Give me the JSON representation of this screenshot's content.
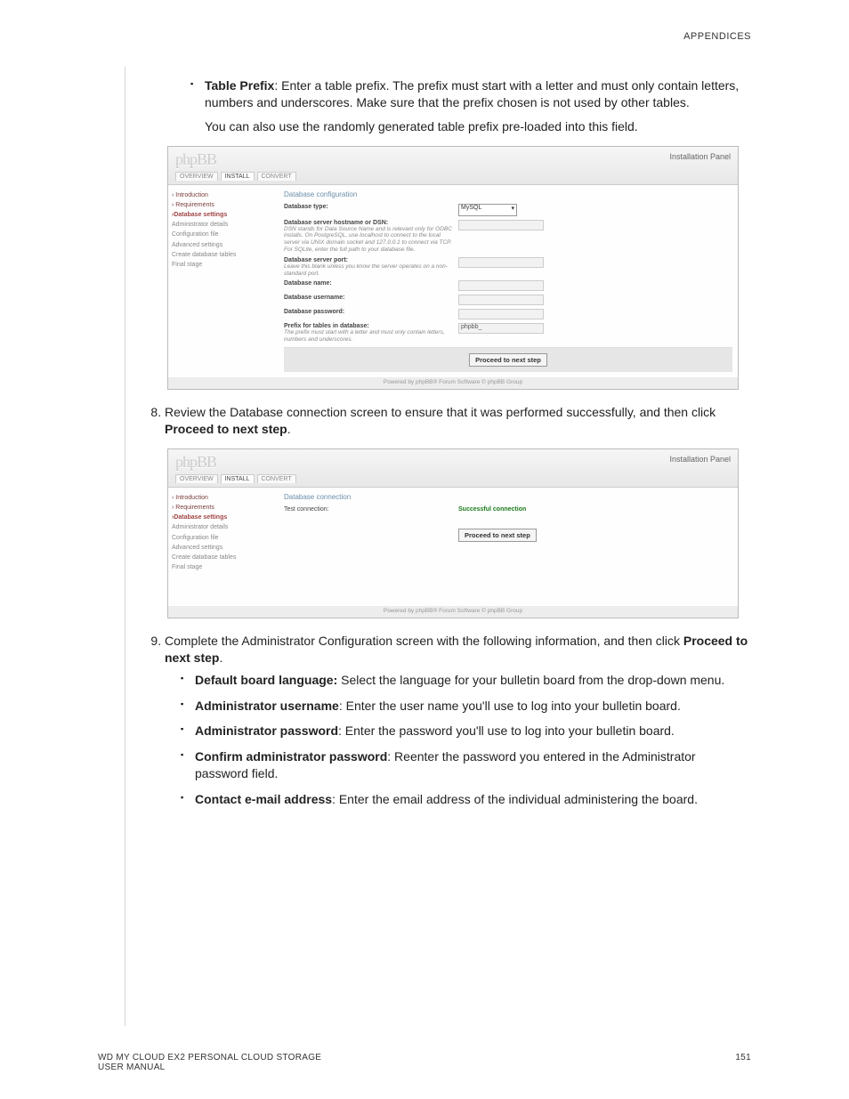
{
  "header": {
    "section": "APPENDICES"
  },
  "body": {
    "tablePrefix": {
      "label": "Table Prefix",
      "text": ": Enter a table prefix. The prefix must start with a letter and must only contain letters, numbers and underscores. Make sure that the prefix chosen is not used by other tables.",
      "note": "You can also use the randomly generated table prefix pre-loaded into this field."
    },
    "step8": "Review the Database connection screen to ensure that it was performed successfully, and then click ",
    "step8bold": "Proceed to next step",
    "step8end": ".",
    "step9": "Complete the Administrator Configuration screen with the following information, and then click ",
    "step9bold": "Proceed to next step",
    "step9end": ".",
    "items9": [
      {
        "b": "Default board language:",
        "t": " Select the language for your bulletin board from the drop-down menu."
      },
      {
        "b": "Administrator username",
        "t": ": Enter the user name you'll use to log into your bulletin board."
      },
      {
        "b": "Administrator password",
        "t": ": Enter the password you'll use to log into your bulletin board."
      },
      {
        "b": "Confirm administrator password",
        "t": ": Reenter the password you entered in the Administrator password field."
      },
      {
        "b": "Contact e-mail address",
        "t": ": Enter the email address of the individual administering the board."
      }
    ]
  },
  "screenshot1": {
    "logo": "phpBB",
    "panel": "Installation Panel",
    "tabs": [
      "OVERVIEW",
      "INSTALL",
      "CONVERT"
    ],
    "sidebar": {
      "done": [
        "› Introduction",
        "› Requirements"
      ],
      "current": "›Database settings",
      "future": [
        "Administrator details",
        "Configuration file",
        "Advanced settings",
        "Create database tables",
        "Final stage"
      ]
    },
    "section": "Database configuration",
    "rows": {
      "dbtype": "Database type:",
      "dbtype_val": "MySQL",
      "dsn": "Database server hostname or DSN:",
      "dsn_hint": "DSN stands for Data Source Name and is relevant only for ODBC installs. On PostgreSQL, use localhost to connect to the local server via UNIX domain socket and 127.0.0.1 to connect via TCP. For SQLite, enter the full path to your database file.",
      "port": "Database server port:",
      "port_hint": "Leave this blank unless you know the server operates on a non-standard port.",
      "dbname": "Database name:",
      "dbuser": "Database username:",
      "dbpass": "Database password:",
      "prefix": "Prefix for tables in database:",
      "prefix_hint": "The prefix must start with a letter and must only contain letters, numbers and underscores.",
      "prefix_val": "phpbb_"
    },
    "button": "Proceed to next step",
    "footer": "Powered by phpBB® Forum Software © phpBB Group"
  },
  "screenshot2": {
    "logo": "phpBB",
    "panel": "Installation Panel",
    "tabs": [
      "OVERVIEW",
      "INSTALL",
      "CONVERT"
    ],
    "sidebar": {
      "done": [
        "› Introduction",
        "› Requirements"
      ],
      "current": "›Database settings",
      "future": [
        "Administrator details",
        "Configuration file",
        "Advanced settings",
        "Create database tables",
        "Final stage"
      ]
    },
    "section": "Database connection",
    "test_label": "Test connection:",
    "test_result": "Successful connection",
    "button": "Proceed to next step",
    "footer": "Powered by phpBB® Forum Software © phpBB Group"
  },
  "footer": {
    "left1": "WD MY CLOUD EX2 PERSONAL CLOUD STORAGE",
    "left2": "USER MANUAL",
    "page": "151"
  }
}
